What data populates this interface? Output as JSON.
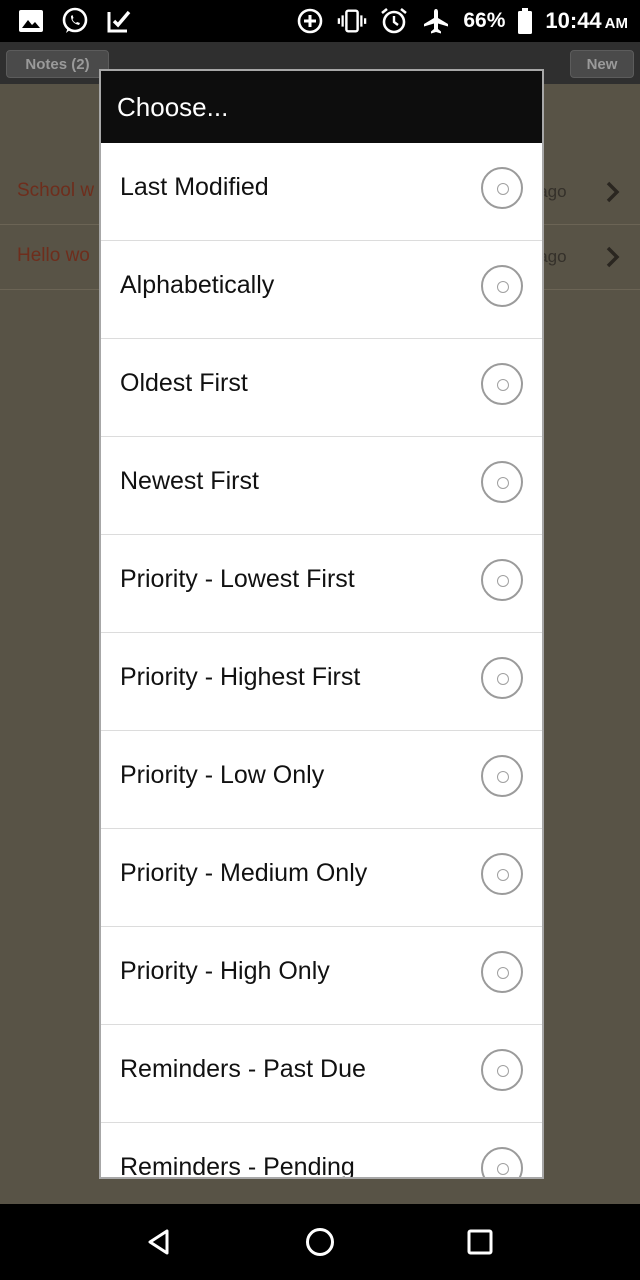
{
  "status_bar": {
    "left_icons": [
      "gallery-icon",
      "whatsapp-icon",
      "download-done-icon"
    ],
    "right_icons": [
      "data-saver-icon",
      "vibrate-icon",
      "alarm-icon",
      "airplane-mode-icon",
      "battery-icon"
    ],
    "battery": "66%",
    "time": "10:44",
    "ampm": "AM"
  },
  "app": {
    "notes_button": "Notes (2)",
    "new_button": "New",
    "notes": [
      {
        "title": "School w",
        "time": "s ago"
      },
      {
        "title": "Hello wo",
        "time": "s ago"
      }
    ]
  },
  "dialog": {
    "title": "Choose...",
    "options": [
      {
        "label": "Last Modified",
        "selected": false
      },
      {
        "label": "Alphabetically",
        "selected": false
      },
      {
        "label": "Oldest First",
        "selected": false
      },
      {
        "label": "Newest First",
        "selected": false
      },
      {
        "label": "Priority - Lowest First",
        "selected": false
      },
      {
        "label": "Priority - Highest First",
        "selected": false
      },
      {
        "label": "Priority - Low Only",
        "selected": false
      },
      {
        "label": "Priority - Medium Only",
        "selected": false
      },
      {
        "label": "Priority - High Only",
        "selected": false
      },
      {
        "label": "Reminders - Past Due",
        "selected": false
      },
      {
        "label": "Reminders - Pending",
        "selected": false
      }
    ]
  },
  "nav_bar": {
    "icons": [
      "back-icon",
      "home-icon",
      "recents-icon"
    ]
  }
}
